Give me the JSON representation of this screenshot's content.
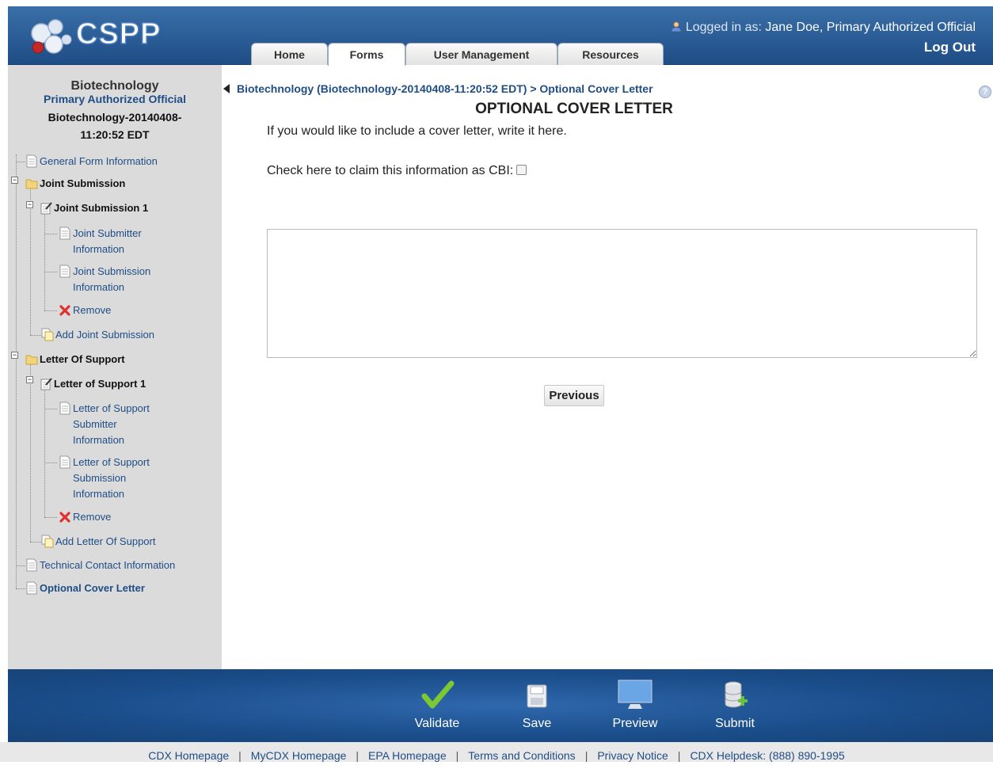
{
  "header": {
    "logo_text": "CSPP",
    "user_prefix": "Logged in as:",
    "user_name": "Jane Doe, Primary Authorized Official",
    "logout": "Log Out",
    "tabs": [
      {
        "label": "Home"
      },
      {
        "label": "Forms"
      },
      {
        "label": "User Management"
      },
      {
        "label": "Resources"
      }
    ],
    "active_tab": "Forms"
  },
  "sidebar": {
    "title": "Biotechnology",
    "role": "Primary Authorized Official",
    "submission_id_line1": "Biotechnology-20140408-",
    "submission_id_line2": "11:20:52 EDT",
    "tree": {
      "general": "General Form Information",
      "joint_submission": "Joint Submission",
      "joint_submission_1": "Joint Submission 1",
      "joint_submitter_info_1": "Joint Submitter",
      "joint_submitter_info_2": "Information",
      "joint_submission_info_1": "Joint Submission",
      "joint_submission_info_2": "Information",
      "remove_1": "Remove",
      "add_joint": "Add Joint Submission",
      "letter_of_support": "Letter Of Support",
      "letter_of_support_1": "Letter of Support 1",
      "los_submitter_1": "Letter of Support",
      "los_submitter_2": "Submitter",
      "los_submitter_3": "Information",
      "los_submission_1": "Letter of Support",
      "los_submission_2": "Submission",
      "los_submission_3": "Information",
      "remove_2": "Remove",
      "add_letter": "Add Letter Of Support",
      "technical_contact": "Technical Contact Information",
      "optional_cover": "Optional Cover Letter"
    }
  },
  "main": {
    "breadcrumb_link": "Biotechnology (Biotechnology-20140408-11:20:52 EDT)",
    "breadcrumb_sep": " > ",
    "breadcrumb_current": "Optional Cover Letter",
    "title": "OPTIONAL COVER LETTER",
    "intro": "If you would like to include a cover letter, write it here.",
    "cbi_label": "Check here to claim this information as CBI:",
    "cbi_checked": false,
    "letter_value": "",
    "previous": "Previous"
  },
  "footer": {
    "buttons": [
      {
        "label": "Validate",
        "icon": "checkmark-icon"
      },
      {
        "label": "Save",
        "icon": "save-icon"
      },
      {
        "label": "Preview",
        "icon": "monitor-icon"
      },
      {
        "label": "Submit",
        "icon": "database-add-icon"
      }
    ]
  },
  "links": [
    "CDX Homepage",
    "MyCDX Homepage",
    "EPA Homepage",
    "Terms and Conditions",
    "Privacy Notice",
    "CDX Helpdesk: (888) 890-1995"
  ],
  "colors": {
    "header_blue": "#1f4d86",
    "link_blue": "#1f4d86",
    "sidebar_gray": "#dbdbdb"
  }
}
